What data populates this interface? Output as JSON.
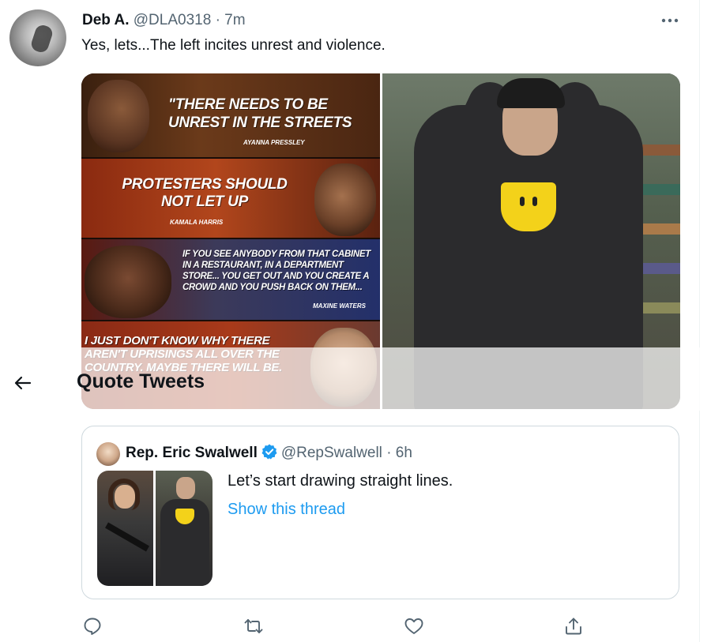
{
  "tweet": {
    "display_name": "Deb A.",
    "handle": "@DLA0318",
    "separator": "·",
    "time": "7m",
    "text": "Yes, lets...The left incites unrest and violence.",
    "more_icon": "more-horizontal-icon"
  },
  "media": {
    "left_image": {
      "panels": [
        {
          "quote": "\"There needs to be unrest in the streets",
          "attribution": "AYANNA PRESSLEY"
        },
        {
          "quote": "Protesters should not let up",
          "attribution": "KAMALA HARRIS"
        },
        {
          "quote": "If you see anybody from that cabinet in a restaurant, in a department store... you get out and you create a crowd and you push back on them...",
          "attribution": "MAXINE WATERS"
        },
        {
          "quote": "I just don't know why there aren't uprisings all over the country. Maybe there will be."
        }
      ]
    },
    "right_image": {
      "description_icon": "photo-icon"
    }
  },
  "overlay": {
    "back_icon": "arrow-left-icon",
    "title": "Quote Tweets"
  },
  "quoted_tweet": {
    "display_name": "Rep. Eric Swalwell",
    "verified_icon": "verified-badge-icon",
    "handle": "@RepSwalwell",
    "separator": "·",
    "time": "6h",
    "text": "Let’s start drawing straight lines.",
    "link": "Show this thread"
  },
  "actions": [
    {
      "name": "reply",
      "icon": "reply-icon"
    },
    {
      "name": "retweet",
      "icon": "retweet-icon"
    },
    {
      "name": "like",
      "icon": "heart-icon"
    },
    {
      "name": "share",
      "icon": "share-icon"
    }
  ],
  "colors": {
    "accent": "#1d9bf0",
    "text_primary": "#0f1419",
    "text_secondary": "#536471",
    "border": "#cfd9de"
  }
}
